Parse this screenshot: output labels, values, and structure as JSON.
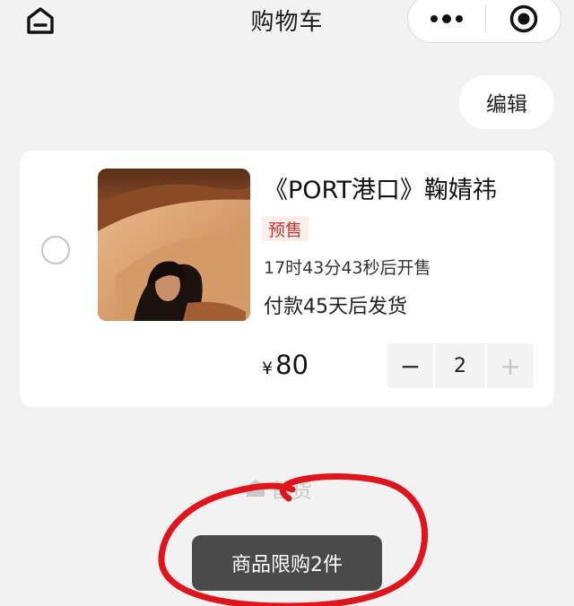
{
  "header": {
    "title": "购物车",
    "icons": {
      "home": "home-icon",
      "more": "more-dots-icon",
      "close": "target-circle-icon"
    }
  },
  "toolbar": {
    "edit_label": "编辑"
  },
  "cart": {
    "items": [
      {
        "selected": false,
        "name": "《PORT港口》鞠婧祎",
        "badge": "预售",
        "countdown": "17时43分43秒后开售",
        "shipping": "付款45天后发货",
        "currency": "¥",
        "price": "80",
        "quantity": "2",
        "minus_label": "−",
        "plus_label": "+"
      }
    ]
  },
  "bottom": {
    "faded_label": "首货"
  },
  "toast": {
    "message": "商品限购2件"
  },
  "colors": {
    "background": "#f2f2f2",
    "badge_text": "#d0312d",
    "badge_bg": "#fdeeee",
    "toast_bg": "#4a4a4a",
    "annotation": "#e0141b"
  }
}
